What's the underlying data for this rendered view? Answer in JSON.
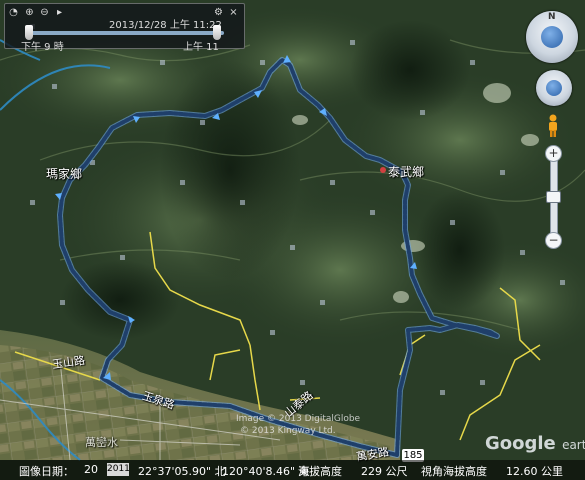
{
  "time_slider": {
    "date_label": "2013/12/28  上午   11:22",
    "start_label": "下午    9 時",
    "end_label": "上午   11",
    "buttons": [
      "clock-icon",
      "zoom-in-icon",
      "zoom-out-icon",
      "play-icon",
      "settings-icon",
      "close-icon"
    ]
  },
  "nav": {
    "north_label": "N",
    "zoom_in": "+",
    "zoom_out": "−"
  },
  "places": {
    "village_a": "瑪家鄉",
    "village_b": "泰武鄉",
    "road_a": "玉山路",
    "road_b": "玉泉路",
    "road_c": "山泰路",
    "road_d": "萬安路",
    "route_shield": "185",
    "bottom_left": "萬巒水"
  },
  "copyright": {
    "line1": "Image © 2013 DigitalGlobe",
    "line2": "© 2013 Kingway Ltd."
  },
  "logo": {
    "google": "Google",
    "earth": "earth"
  },
  "status_bar": {
    "image_date_label": "圖像日期：",
    "image_date_value": "20",
    "stream_year": "2011",
    "latitude": "22°37'05.90\" 北",
    "longitude": "120°40'8.46\" 東",
    "elevation_label": "海拔高度",
    "elevation_value": "229 公尺",
    "eye_alt_label": "視角海拔高度",
    "eye_alt_value": "12.60 公里"
  },
  "colors": {
    "track": "#1f3f6a",
    "track_glow": "#6ea6e6",
    "yellow_road": "#e6d84a",
    "water": "#2e8bc4",
    "panel_bg": "#12161a"
  }
}
